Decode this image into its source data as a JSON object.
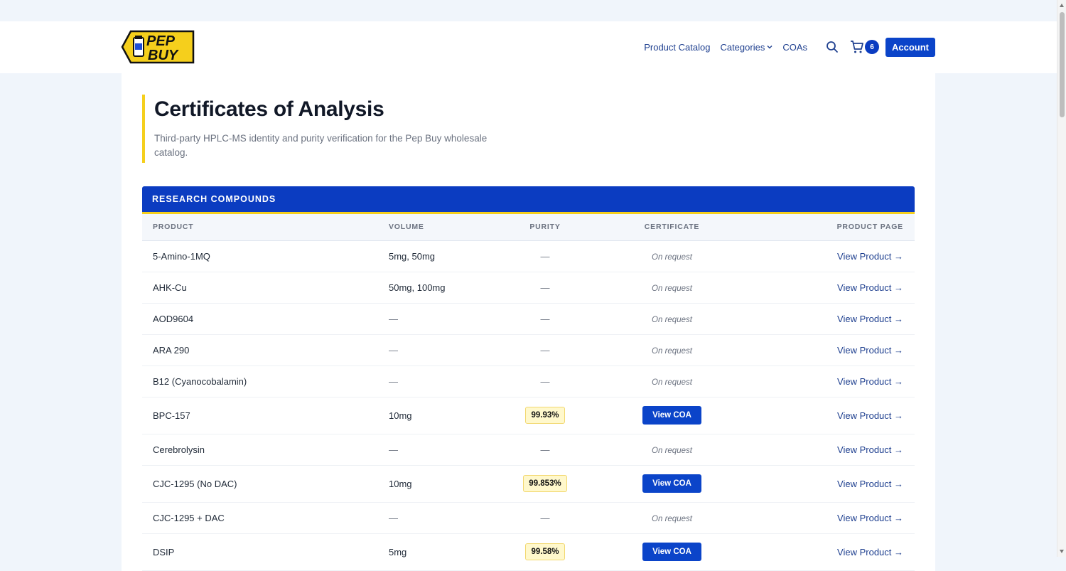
{
  "brand": {
    "logo_line1": "PEP",
    "logo_line2": "BUY",
    "yellow": "#f5cf1c",
    "blue": "#0b3cc1"
  },
  "nav": {
    "items": [
      {
        "label": "Product Catalog"
      },
      {
        "label": "Categories"
      },
      {
        "label": "COAs"
      }
    ],
    "cart_count": "6",
    "account_label": "Account"
  },
  "hero": {
    "title": "Certificates of Analysis",
    "subtitle": "Third-party HPLC-MS identity and purity verification for the Pep Buy wholesale catalog."
  },
  "section": {
    "title": "RESEARCH COMPOUNDS",
    "columns": [
      "PRODUCT",
      "VOLUME",
      "PURITY",
      "CERTIFICATE",
      "PRODUCT PAGE"
    ],
    "rows": [
      {
        "product": "5-Amino-1MQ",
        "volume": "5mg, 50mg",
        "purity": "—",
        "certificate": "On request",
        "link": "View Product →"
      },
      {
        "product": "AHK-Cu",
        "volume": "50mg, 100mg",
        "purity": "—",
        "certificate": "On request",
        "link": "View Product →"
      },
      {
        "product": "AOD9604",
        "volume": "—",
        "purity": "—",
        "certificate": "On request",
        "link": "View Product →"
      },
      {
        "product": "ARA 290",
        "volume": "—",
        "purity": "—",
        "certificate": "On request",
        "link": "View Product →"
      },
      {
        "product": "B12 (Cyanocobalamin)",
        "volume": "—",
        "purity": "—",
        "certificate": "On request",
        "link": "View Product →"
      },
      {
        "product": "BPC-157",
        "volume": "10mg",
        "purity": "99.93%",
        "certificate": "View COA",
        "link": "View Product →"
      },
      {
        "product": "Cerebrolysin",
        "volume": "—",
        "purity": "—",
        "certificate": "On request",
        "link": "View Product →"
      },
      {
        "product": "CJC-1295 (No DAC)",
        "volume": "10mg",
        "purity": "99.853%",
        "certificate": "View COA",
        "link": "View Product →"
      },
      {
        "product": "CJC-1295 + DAC",
        "volume": "—",
        "purity": "—",
        "certificate": "On request",
        "link": "View Product →"
      },
      {
        "product": "DSIP",
        "volume": "5mg",
        "purity": "99.58%",
        "certificate": "View COA",
        "link": "View Product →"
      }
    ]
  }
}
